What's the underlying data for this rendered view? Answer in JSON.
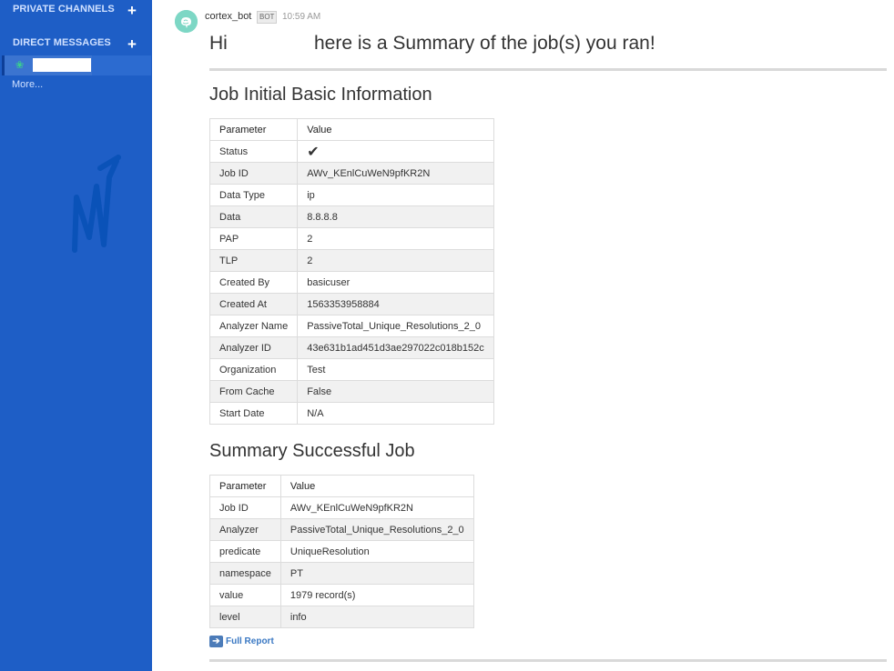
{
  "sidebar": {
    "private_channels_label": "PRIVATE CHANNELS",
    "direct_messages_label": "DIRECT MESSAGES",
    "plus_icon": "+",
    "more_label": "More...",
    "accent": "#1e5ec6"
  },
  "message": {
    "username": "cortex_bot",
    "badge": "BOT",
    "time": "10:59 AM",
    "greeting_hi": "Hi",
    "greeting_rest": "here is a Summary of the job(s) you ran!"
  },
  "basic_info": {
    "title": "Job Initial Basic Information",
    "headers": [
      "Parameter",
      "Value"
    ],
    "rows": [
      [
        "Status",
        "✔"
      ],
      [
        "Job ID",
        "AWv_KEnlCuWeN9pfKR2N"
      ],
      [
        "Data Type",
        "ip"
      ],
      [
        "Data",
        "8.8.8.8"
      ],
      [
        "PAP",
        "2"
      ],
      [
        "TLP",
        "2"
      ],
      [
        "Created By",
        "basicuser"
      ],
      [
        "Created At",
        "1563353958884"
      ],
      [
        "Analyzer Name",
        "PassiveTotal_Unique_Resolutions_2_0"
      ],
      [
        "Analyzer ID",
        "43e631b1ad451d3ae297022c018b152c"
      ],
      [
        "Organization",
        "Test"
      ],
      [
        "From Cache",
        "False"
      ],
      [
        "Start Date",
        "N/A"
      ]
    ]
  },
  "summary": {
    "title": "Summary Successful Job",
    "headers": [
      "Parameter",
      "Value"
    ],
    "rows": [
      [
        "Job ID",
        "AWv_KEnlCuWeN9pfKR2N"
      ],
      [
        "Analyzer",
        "PassiveTotal_Unique_Resolutions_2_0"
      ],
      [
        "predicate",
        "UniqueResolution"
      ],
      [
        "namespace",
        "PT"
      ],
      [
        "value",
        "1979 record(s)"
      ],
      [
        "level",
        "info"
      ]
    ]
  },
  "report": {
    "icon": "arrow-right-icon",
    "label": "Full Report"
  }
}
